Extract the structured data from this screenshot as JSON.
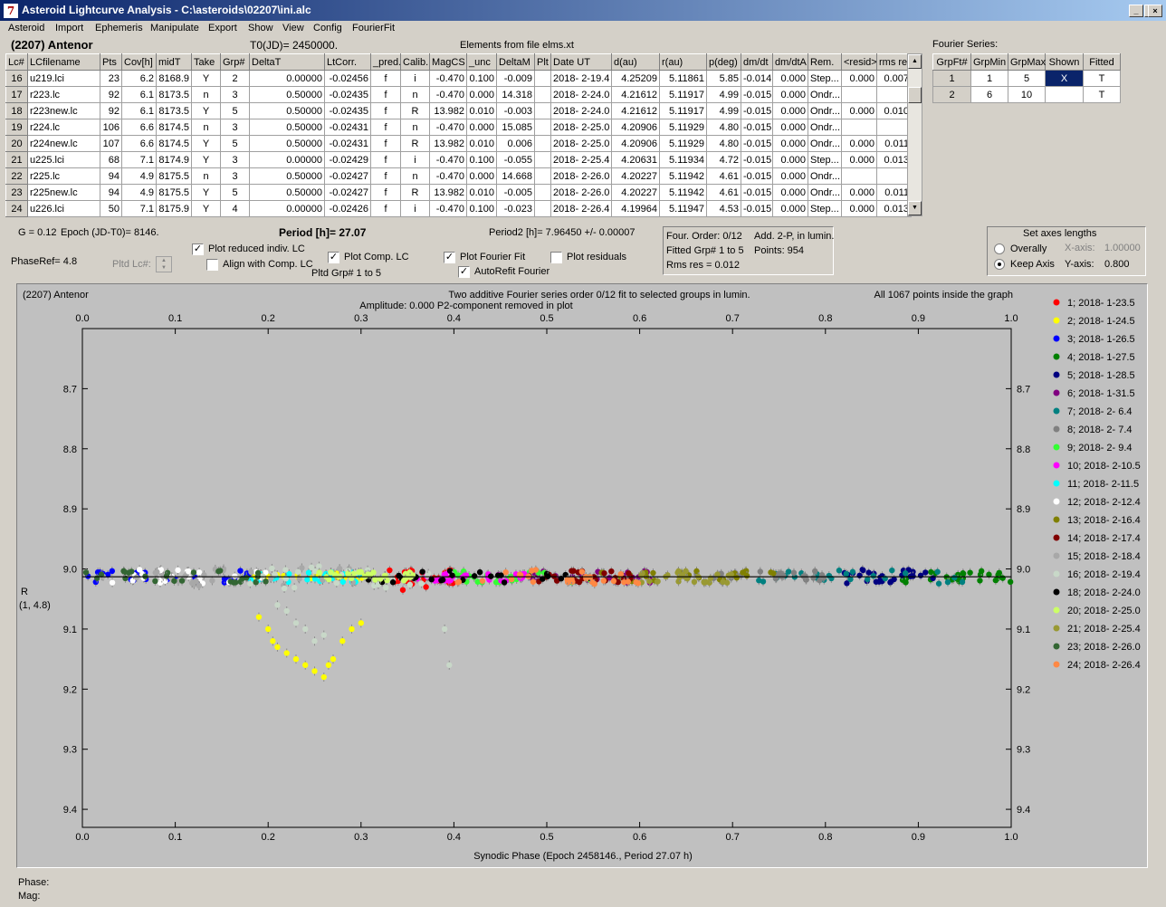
{
  "window": {
    "title": "Asteroid Lightcurve Analysis - C:\\asteroids\\02207\\ini.alc",
    "minimize": "_",
    "maximize": "□",
    "close": "×"
  },
  "menu": [
    "Asteroid",
    "Import",
    "Ephemeris",
    "Manipulate",
    "Export",
    "Show",
    "View",
    "Config",
    "FourierFit"
  ],
  "header": {
    "asteroid": "(2207) Antenor",
    "t0": "T0(JD)= 2450000.",
    "elements": "Elements from file elms.xt"
  },
  "lc_table": {
    "columns": [
      "Lc#",
      "LCfilename",
      "Pts",
      "Cov[h]",
      "midT",
      "Take",
      "Grp#",
      "DeltaT",
      "LtCorr.",
      "_pred.",
      "Calib.",
      "MagCS",
      "_unc",
      "DeltaM",
      "Plt",
      "Date UT",
      "d(au)",
      "r(au)",
      "p(deg)",
      "dm/dt",
      "dm/dtA",
      "Rem.",
      "<resid>",
      "rms res"
    ],
    "rows": [
      [
        "16",
        "u219.lci",
        "23",
        "6.2",
        "8168.9",
        "Y",
        "2",
        "0.00000",
        "-0.02456",
        "f",
        "i",
        "-0.470",
        "0.100",
        "-0.009",
        "",
        "2018- 2-19.4",
        "4.25209",
        "5.11861",
        "5.85",
        "-0.014",
        "0.000",
        "Step...",
        "0.000",
        "0.007"
      ],
      [
        "17",
        "r223.lc",
        "92",
        "6.1",
        "8173.5",
        "n",
        "3",
        "0.50000",
        "-0.02435",
        "f",
        "n",
        "-0.470",
        "0.000",
        "14.318",
        "",
        "2018- 2-24.0",
        "4.21612",
        "5.11917",
        "4.99",
        "-0.015",
        "0.000",
        "Ondr...",
        "",
        ""
      ],
      [
        "18",
        "r223new.lc",
        "92",
        "6.1",
        "8173.5",
        "Y",
        "5",
        "0.50000",
        "-0.02435",
        "f",
        "R",
        "13.982",
        "0.010",
        "-0.003",
        "",
        "2018- 2-24.0",
        "4.21612",
        "5.11917",
        "4.99",
        "-0.015",
        "0.000",
        "Ondr...",
        "0.000",
        "0.010"
      ],
      [
        "19",
        "r224.lc",
        "106",
        "6.6",
        "8174.5",
        "n",
        "3",
        "0.50000",
        "-0.02431",
        "f",
        "n",
        "-0.470",
        "0.000",
        "15.085",
        "",
        "2018- 2-25.0",
        "4.20906",
        "5.11929",
        "4.80",
        "-0.015",
        "0.000",
        "Ondr...",
        "",
        ""
      ],
      [
        "20",
        "r224new.lc",
        "107",
        "6.6",
        "8174.5",
        "Y",
        "5",
        "0.50000",
        "-0.02431",
        "f",
        "R",
        "13.982",
        "0.010",
        "0.006",
        "",
        "2018- 2-25.0",
        "4.20906",
        "5.11929",
        "4.80",
        "-0.015",
        "0.000",
        "Ondr...",
        "0.000",
        "0.011"
      ],
      [
        "21",
        "u225.lci",
        "68",
        "7.1",
        "8174.9",
        "Y",
        "3",
        "0.00000",
        "-0.02429",
        "f",
        "i",
        "-0.470",
        "0.100",
        "-0.055",
        "",
        "2018- 2-25.4",
        "4.20631",
        "5.11934",
        "4.72",
        "-0.015",
        "0.000",
        "Step...",
        "0.000",
        "0.013"
      ],
      [
        "22",
        "r225.lc",
        "94",
        "4.9",
        "8175.5",
        "n",
        "3",
        "0.50000",
        "-0.02427",
        "f",
        "n",
        "-0.470",
        "0.000",
        "14.668",
        "",
        "2018- 2-26.0",
        "4.20227",
        "5.11942",
        "4.61",
        "-0.015",
        "0.000",
        "Ondr...",
        "",
        ""
      ],
      [
        "23",
        "r225new.lc",
        "94",
        "4.9",
        "8175.5",
        "Y",
        "5",
        "0.50000",
        "-0.02427",
        "f",
        "R",
        "13.982",
        "0.010",
        "-0.005",
        "",
        "2018- 2-26.0",
        "4.20227",
        "5.11942",
        "4.61",
        "-0.015",
        "0.000",
        "Ondr...",
        "0.000",
        "0.011"
      ],
      [
        "24",
        "u226.lci",
        "50",
        "7.1",
        "8175.9",
        "Y",
        "4",
        "0.00000",
        "-0.02426",
        "f",
        "i",
        "-0.470",
        "0.100",
        "-0.023",
        "",
        "2018- 2-26.4",
        "4.19964",
        "5.11947",
        "4.53",
        "-0.015",
        "0.000",
        "Step...",
        "0.000",
        "0.013"
      ]
    ]
  },
  "fourier_series": {
    "label": "Fourier Series:",
    "columns": [
      "GrpFt#",
      "GrpMin",
      "GrpMax",
      "Shown",
      "Fitted"
    ],
    "rows": [
      [
        "1",
        "1",
        "5",
        "X",
        "T"
      ],
      [
        "2",
        "6",
        "10",
        "",
        "T"
      ]
    ]
  },
  "controls": {
    "g": "G = 0.12",
    "epoch": "Epoch (JD-T0)= 8146.",
    "period": "Period [h]= 27.07",
    "period2": "Period2 [h]= 7.96450 +/- 0.00007",
    "phaseref": "PhaseRef= 4.8",
    "pltd_lc": "Pltd Lc#:",
    "plot_reduced": "Plot reduced indiv. LC",
    "align_comp": "Align with Comp. LC",
    "plot_comp": "Plot Comp. LC",
    "pltd_grp": "Pltd Grp#  1   to   5",
    "plot_fourier": "Plot Fourier Fit",
    "autorefit": "AutoRefit Fourier",
    "plot_residuals": "Plot residuals",
    "four_order": "Four. Order:  0/12",
    "add2p": "Add. 2-P, in lumin.",
    "fitted_grp": "Fitted Grp# 1 to 5",
    "points": "Points: 954",
    "rms": "Rms res     = 0.012",
    "axes_title": "Set axes lengths",
    "overally": "Overally",
    "keep_axis": "Keep Axis",
    "xaxis_label": "X-axis:",
    "xaxis_val": "1.00000",
    "yaxis_label": "Y-axis:",
    "yaxis_val": "0.800",
    "check_mark": "✓",
    "spin_up": "▲",
    "spin_down": "▼",
    "scroll_up": "▲",
    "scroll_down": "▼"
  },
  "plot": {
    "name": "(2207) Antenor",
    "info1": "Two additive Fourier series order 0/12 fit to selected groups in lumin.",
    "info2": "Amplitude: 0.000               P2-component removed in plot",
    "count": "All 1067 points inside the graph",
    "ylabel1": "R",
    "ylabel2": "(1, 4.8)",
    "xlabel": "Synodic Phase (Epoch 2458146., Period 27.07 h)"
  },
  "status": {
    "phase": "Phase:",
    "mag": "Mag:"
  },
  "chart_data": {
    "type": "scatter",
    "title": "",
    "xlabel": "Synodic Phase (Epoch 2458146., Period 27.07 h)",
    "ylabel": "R",
    "xlim": [
      0.0,
      1.0
    ],
    "ylim": [
      8.6,
      9.43
    ],
    "y_inverted": true,
    "xticks": [
      0.0,
      0.1,
      0.2,
      0.3,
      0.4,
      0.5,
      0.6,
      0.7,
      0.8,
      0.9,
      1.0
    ],
    "yticks": [
      8.7,
      8.8,
      8.9,
      9.0,
      9.1,
      9.2,
      9.3,
      9.4
    ],
    "grid": false,
    "legend_position": "right",
    "fit_line_y": 9.013,
    "series": [
      {
        "name": "1; 2018- 1-23.5",
        "color": "#ff0000",
        "phase_range": [
          0.33,
          0.4
        ],
        "scatter": 0.012,
        "points": [
          [
            0.34,
            9.02
          ],
          [
            0.355,
            9.025
          ],
          [
            0.37,
            9.03
          ],
          [
            0.385,
            9.02
          ],
          [
            0.395,
            9.01
          ],
          [
            0.345,
            9.035
          ]
        ]
      },
      {
        "name": "2; 2018- 1-24.5",
        "color": "#ffff00",
        "phase_range": [
          0.18,
          0.31
        ],
        "scatter": 0.006,
        "points": [
          [
            0.19,
            9.08
          ],
          [
            0.2,
            9.1
          ],
          [
            0.205,
            9.12
          ],
          [
            0.21,
            9.13
          ],
          [
            0.22,
            9.14
          ],
          [
            0.23,
            9.15
          ],
          [
            0.24,
            9.16
          ],
          [
            0.25,
            9.17
          ],
          [
            0.26,
            9.18
          ],
          [
            0.265,
            9.16
          ],
          [
            0.27,
            9.15
          ],
          [
            0.28,
            9.12
          ],
          [
            0.29,
            9.1
          ],
          [
            0.3,
            9.09
          ]
        ]
      },
      {
        "name": "3; 2018- 1-26.5",
        "color": "#0000ff",
        "phase_range": [
          0.0,
          0.2
        ],
        "scatter": 0.01
      },
      {
        "name": "4; 2018- 1-27.5",
        "color": "#008000",
        "phase_range": [
          0.88,
          1.0
        ],
        "scatter": 0.01
      },
      {
        "name": "5; 2018- 1-28.5",
        "color": "#000080",
        "phase_range": [
          0.82,
          0.92
        ],
        "scatter": 0.012
      },
      {
        "name": "6; 2018- 1-31.5",
        "color": "#800080",
        "phase_range": [
          0.48,
          0.62
        ],
        "scatter": 0.01
      },
      {
        "name": "7; 2018- 2- 6.4",
        "color": "#008080",
        "phase_range": [
          0.72,
          0.95
        ],
        "scatter": 0.012
      },
      {
        "name": "8; 2018- 2- 7.4",
        "color": "#808080",
        "phase_range": [
          0.65,
          0.8
        ],
        "scatter": 0.01
      },
      {
        "name": "9; 2018- 2- 9.4",
        "color": "#33ff33",
        "phase_range": [
          0.4,
          0.55
        ],
        "scatter": 0.01
      },
      {
        "name": "10; 2018- 2-10.5",
        "color": "#ff00ff",
        "phase_range": [
          0.36,
          0.48
        ],
        "scatter": 0.008
      },
      {
        "name": "11; 2018- 2-11.5",
        "color": "#00ffff",
        "phase_range": [
          0.18,
          0.3
        ],
        "scatter": 0.01
      },
      {
        "name": "12; 2018- 2-12.4",
        "color": "#ffffff",
        "phase_range": [
          0.02,
          0.2
        ],
        "scatter": 0.012
      },
      {
        "name": "13; 2018- 2-16.4",
        "color": "#808000",
        "phase_range": [
          0.55,
          0.75
        ],
        "scatter": 0.01
      },
      {
        "name": "14; 2018- 2-17.4",
        "color": "#800000",
        "phase_range": [
          0.48,
          0.6
        ],
        "scatter": 0.01
      },
      {
        "name": "15; 2018- 2-18.4",
        "color": "#a8a8a8",
        "phase_range": [
          0.02,
          0.32
        ],
        "scatter": 0.015
      },
      {
        "name": "16; 2018- 2-19.4",
        "color": "#c8d8c8",
        "phase_range": [
          0.18,
          0.4
        ],
        "scatter": 0.02,
        "points": [
          [
            0.21,
            9.06
          ],
          [
            0.22,
            9.07
          ],
          [
            0.23,
            9.09
          ],
          [
            0.24,
            9.1
          ],
          [
            0.25,
            9.12
          ],
          [
            0.26,
            9.11
          ],
          [
            0.39,
            9.1
          ],
          [
            0.395,
            9.16
          ]
        ]
      },
      {
        "name": "18; 2018- 2-24.0",
        "color": "#000000",
        "phase_range": [
          0.3,
          0.55
        ],
        "scatter": 0.01
      },
      {
        "name": "20; 2018- 2-25.0",
        "color": "#ccff66",
        "phase_range": [
          0.24,
          0.36
        ],
        "scatter": 0.008
      },
      {
        "name": "21; 2018- 2-25.4",
        "color": "#999933",
        "phase_range": [
          0.6,
          0.7
        ],
        "scatter": 0.01
      },
      {
        "name": "23; 2018- 2-26.0",
        "color": "#336633",
        "phase_range": [
          0.0,
          0.2
        ],
        "scatter": 0.01
      },
      {
        "name": "24; 2018- 2-26.4",
        "color": "#ff8844",
        "phase_range": [
          0.4,
          0.62
        ],
        "scatter": 0.012
      }
    ]
  }
}
